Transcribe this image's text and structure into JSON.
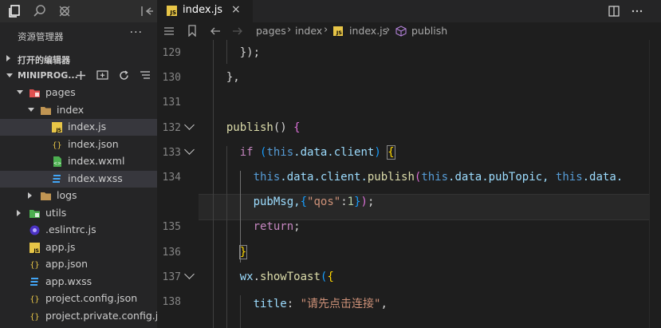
{
  "sidebar": {
    "title": "资源管理器",
    "more": "···",
    "open_editors_label": "打开的编辑器",
    "project_label": "MINIPROG...",
    "tree": [
      {
        "name": "pages",
        "depth": 1,
        "type": "folder-red",
        "expanded": true
      },
      {
        "name": "index",
        "depth": 2,
        "type": "folder",
        "expanded": true
      },
      {
        "name": "index.js",
        "depth": 3,
        "type": "js",
        "selected": true
      },
      {
        "name": "index.json",
        "depth": 3,
        "type": "json"
      },
      {
        "name": "index.wxml",
        "depth": 3,
        "type": "wxml"
      },
      {
        "name": "index.wxss",
        "depth": 3,
        "type": "wxss",
        "hover": true
      },
      {
        "name": "logs",
        "depth": 2,
        "type": "folder",
        "expanded": false
      },
      {
        "name": "utils",
        "depth": 1,
        "type": "folder-green",
        "expanded": false
      },
      {
        "name": ".eslintrc.js",
        "depth": 1,
        "type": "eslint"
      },
      {
        "name": "app.js",
        "depth": 1,
        "type": "js"
      },
      {
        "name": "app.json",
        "depth": 1,
        "type": "json"
      },
      {
        "name": "app.wxss",
        "depth": 1,
        "type": "wxss"
      },
      {
        "name": "project.config.json",
        "depth": 1,
        "type": "json"
      },
      {
        "name": "project.private.config.js...",
        "depth": 1,
        "type": "json"
      }
    ]
  },
  "tab": {
    "label": "index.js",
    "icon_text": "JS",
    "close": "×"
  },
  "breadcrumb": {
    "items": [
      "pages",
      "index",
      "index.js",
      "publish"
    ]
  },
  "editor": {
    "line_numbers": [
      "129",
      "130",
      "131",
      "132",
      "133",
      "134",
      "",
      "135",
      "136",
      "137",
      "138"
    ],
    "lines": [
      {
        "indent": "    ",
        "parts": [
          {
            "t": "});",
            "c": ""
          }
        ]
      },
      {
        "indent": "  ",
        "parts": [
          {
            "t": "},",
            "c": ""
          }
        ]
      },
      {
        "indent": "",
        "parts": []
      },
      {
        "indent": "  ",
        "parts": [
          {
            "t": "publish",
            "c": "fn"
          },
          {
            "t": "() ",
            "c": ""
          },
          {
            "t": "{",
            "c": "br2"
          }
        ]
      },
      {
        "indent": "    ",
        "parts": [
          {
            "t": "if",
            "c": "ctl"
          },
          {
            "t": " (",
            "c": "br3"
          },
          {
            "t": "this",
            "c": "kw"
          },
          {
            "t": ".data.client",
            "c": "pr"
          },
          {
            "t": ") ",
            "c": "br3"
          },
          {
            "t": "{",
            "c": "br1"
          }
        ]
      },
      {
        "indent": "      ",
        "parts": [
          {
            "t": "this",
            "c": "kw"
          },
          {
            "t": ".data.client.",
            "c": "pr"
          },
          {
            "t": "publish",
            "c": "fn"
          },
          {
            "t": "(",
            "c": "br2"
          },
          {
            "t": "this",
            "c": "kw"
          },
          {
            "t": ".data.pubTopic, ",
            "c": "pr"
          },
          {
            "t": "this",
            "c": "kw"
          },
          {
            "t": ".data.",
            "c": "pr"
          }
        ]
      },
      {
        "indent": "      ",
        "parts": [
          {
            "t": "pubMsg,",
            "c": "pr"
          },
          {
            "t": "{",
            "c": "br3"
          },
          {
            "t": "\"qos\"",
            "c": "st"
          },
          {
            "t": ":",
            "c": ""
          },
          {
            "t": "1",
            "c": "nu"
          },
          {
            "t": "}",
            "c": "br3"
          },
          {
            "t": ")",
            "c": "br2"
          },
          {
            "t": ";",
            "c": ""
          }
        ]
      },
      {
        "indent": "      ",
        "parts": [
          {
            "t": "return",
            "c": "ctl"
          },
          {
            "t": ";",
            "c": ""
          }
        ]
      },
      {
        "indent": "    ",
        "parts": [
          {
            "t": "}",
            "c": "br1"
          }
        ]
      },
      {
        "indent": "    ",
        "parts": [
          {
            "t": "wx",
            "c": "pr"
          },
          {
            "t": ".",
            "c": ""
          },
          {
            "t": "showToast",
            "c": "fn"
          },
          {
            "t": "(",
            "c": "br3"
          },
          {
            "t": "{",
            "c": "br1"
          }
        ]
      },
      {
        "indent": "      ",
        "parts": [
          {
            "t": "title",
            "c": "pr"
          },
          {
            "t": ": ",
            "c": ""
          },
          {
            "t": "\"请先点击连接\"",
            "c": "st"
          },
          {
            "t": ",",
            "c": ""
          }
        ]
      }
    ]
  },
  "colors": {
    "accent": "#007acc",
    "js_icon": "#e7c547",
    "folder": "#c09553",
    "red_folder": "#e05050",
    "green_folder": "#4caf50"
  }
}
